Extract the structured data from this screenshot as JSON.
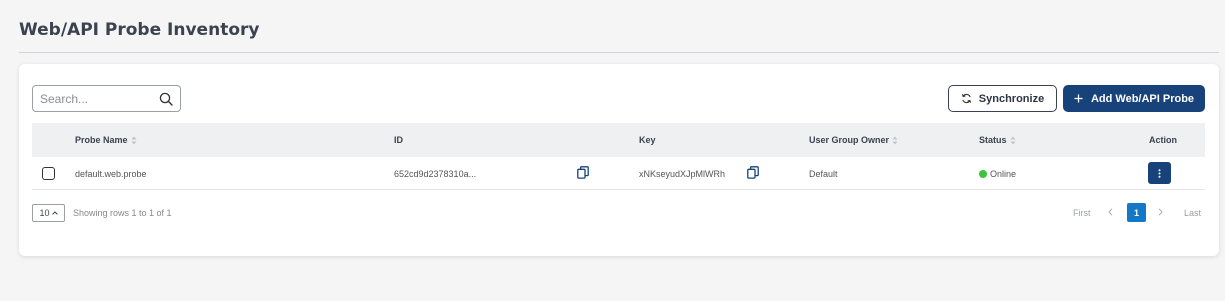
{
  "page": {
    "title": "Web/API Probe Inventory"
  },
  "toolbar": {
    "search_placeholder": "Search...",
    "sync_label": "Synchronize",
    "add_label": "Add Web/API Probe",
    "accent_color": "#17427a"
  },
  "table": {
    "columns": {
      "probe_name": "Probe Name",
      "id": "ID",
      "key": "Key",
      "user_group_owner": "User Group Owner",
      "status": "Status",
      "action": "Action"
    },
    "rows": [
      {
        "probe_name": "default.web.probe",
        "id": "652cd9d2378310a...",
        "key": "xNKseyudXJpMlWRh",
        "user_group_owner": "Default",
        "status": "Online",
        "status_color": "#3cc43c"
      }
    ]
  },
  "pagination": {
    "page_size": "10",
    "rows_info": "Showing rows 1 to 1 of 1",
    "first": "First",
    "last": "Last",
    "current_page": "1"
  },
  "icons": {
    "search": "search-icon",
    "sync": "sync-icon",
    "add": "plus-icon",
    "copy": "copy-icon",
    "sort": "sort-icon",
    "more": "more-vertical-icon",
    "prev": "chevron-left-icon",
    "next": "chevron-right-icon",
    "dropdown": "chevron-up-icon"
  }
}
